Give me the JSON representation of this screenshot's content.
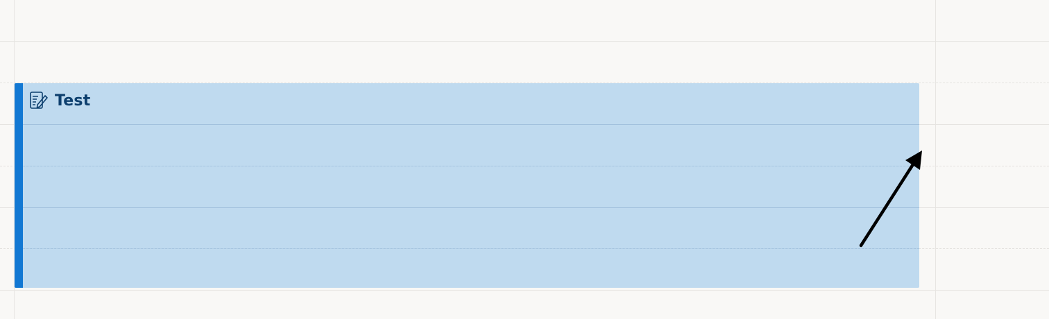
{
  "event": {
    "title": "Test",
    "icon": "edit-note-icon",
    "accent_color": "#1278d3",
    "background_color": "#bcd8ef",
    "title_color": "#0d3f6e"
  },
  "annotation": {
    "icon": "pointer-arrow-icon",
    "color": "#000000"
  }
}
